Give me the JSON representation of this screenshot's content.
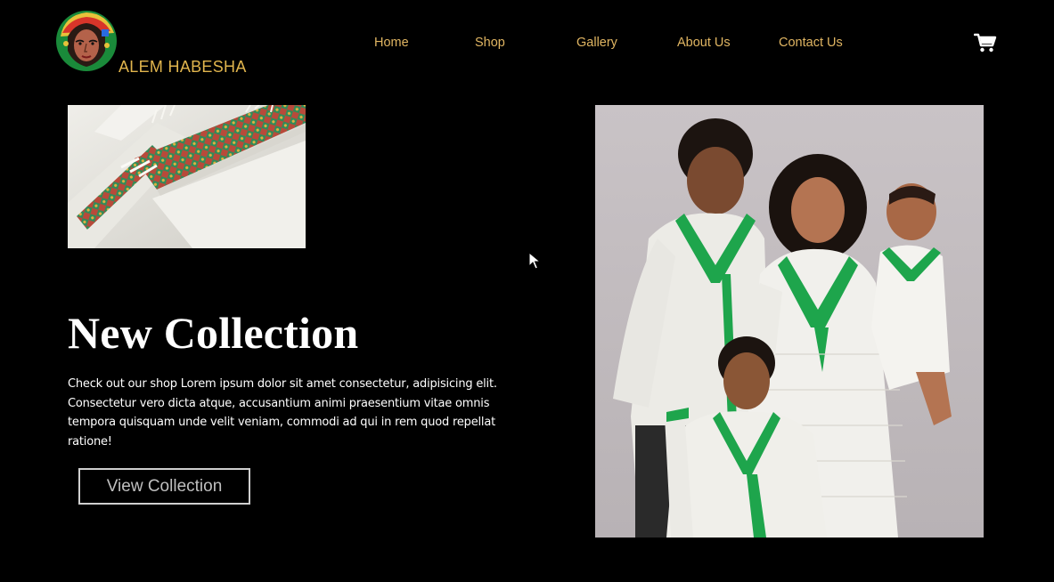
{
  "brand": {
    "name": "ALEM HABESHA"
  },
  "nav": {
    "items": [
      {
        "label": "Home"
      },
      {
        "label": "Shop"
      },
      {
        "label": "Gallery"
      },
      {
        "label": "About Us"
      },
      {
        "label": "Contact Us"
      }
    ]
  },
  "hero": {
    "title": "New Collection",
    "description": "Check out our shop Lorem ipsum dolor sit amet consectetur, adipisicing elit. Consectetur vero dicta atque, accusantium animi praesentium vitae omnis tempora quisquam unde velit veniam, commodi ad qui in rem quod repellat ratione!",
    "cta_label": "View Collection"
  },
  "icons": {
    "cart": "shopping-cart-icon",
    "logo": "habesha-woman-logo",
    "cursor": "mouse-pointer"
  },
  "colors": {
    "background": "#000000",
    "brand_gold": "#e1b54d",
    "nav_gold": "#e0b562",
    "headline": "#ffffff",
    "button_border": "#cfcfcf",
    "button_text": "#bfbfbf",
    "embroidery_green": "#1fa84a"
  }
}
